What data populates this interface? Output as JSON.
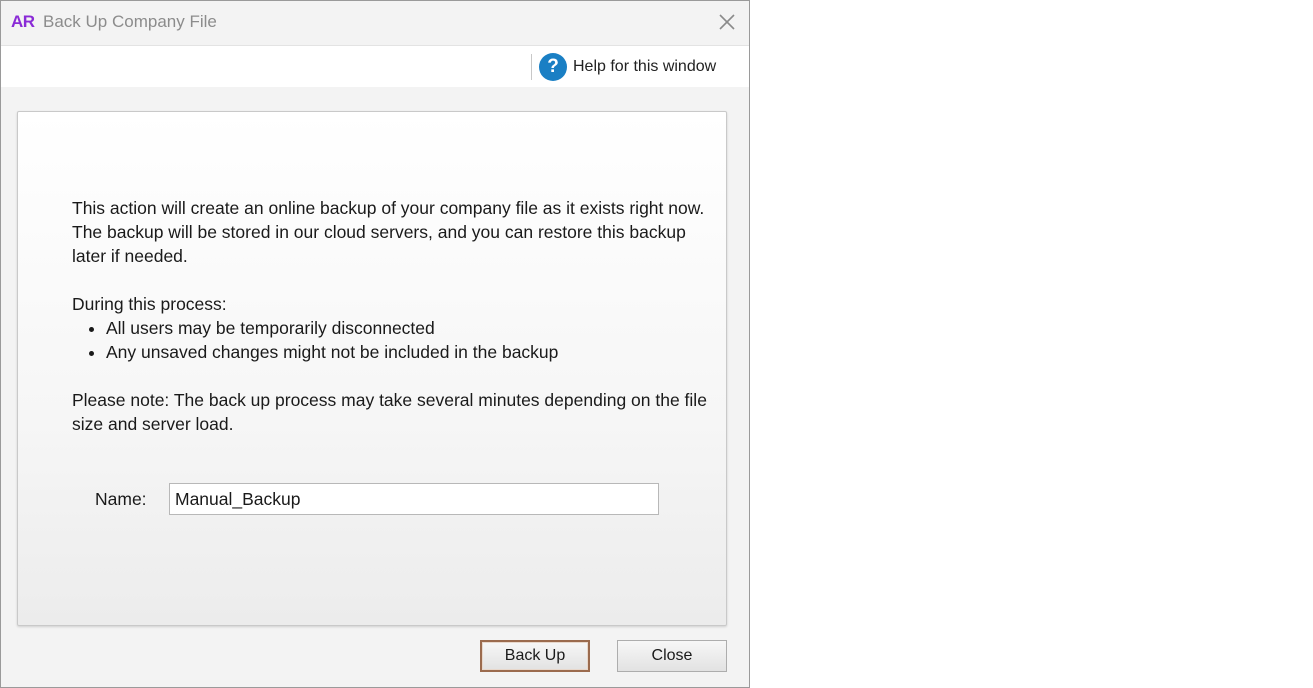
{
  "window": {
    "app_logo": "AR",
    "title": "Back Up Company File"
  },
  "toolbar": {
    "help_label": "Help for this window"
  },
  "panel": {
    "intro_line1": "This action will create an online backup of your company file as it exists right now.",
    "intro_line2": "The backup will be stored in our cloud servers, and you can restore this backup later if needed.",
    "process_heading": "During this process:",
    "bullets": [
      "All users may be temporarily disconnected",
      "Any unsaved changes might not be included in the backup"
    ],
    "note": "Please note: The back up process may take several minutes depending on the file size and server load.",
    "name_label": "Name:",
    "name_value": "Manual_Backup"
  },
  "buttons": {
    "back_up": "Back Up",
    "close": "Close"
  },
  "colors": {
    "logo": "#8a2bd6",
    "help_icon": "#1a7fc4",
    "default_button_border": "#9b6b4e"
  },
  "icons": {
    "help": "question-circle-icon",
    "close": "close-icon"
  }
}
